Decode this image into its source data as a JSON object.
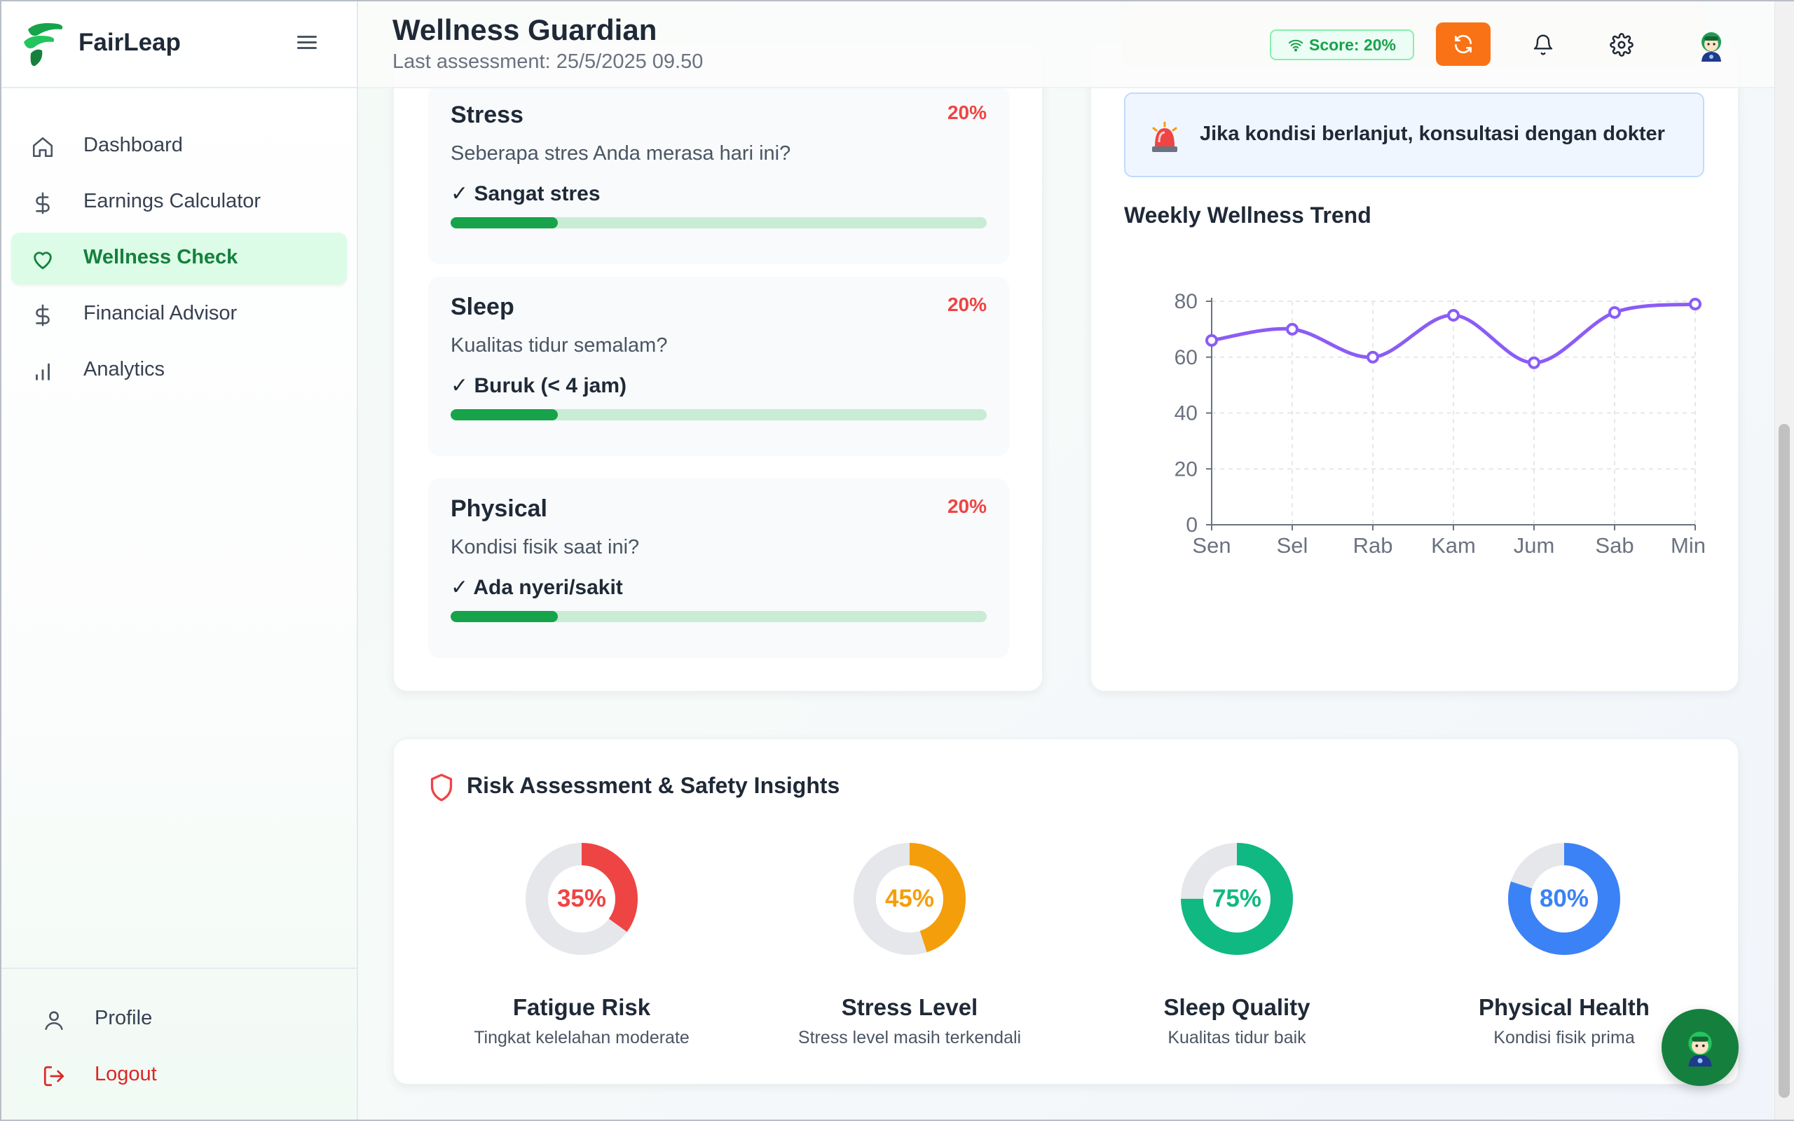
{
  "app": {
    "brand": "FairLeap"
  },
  "sidebar": {
    "items": [
      {
        "label": "Dashboard",
        "icon": "home-icon",
        "active": false
      },
      {
        "label": "Earnings Calculator",
        "icon": "dollar-icon",
        "active": false
      },
      {
        "label": "Wellness Check",
        "icon": "heart-icon",
        "active": true
      },
      {
        "label": "Financial Advisor",
        "icon": "dollar-icon",
        "active": false
      },
      {
        "label": "Analytics",
        "icon": "bar-chart-icon",
        "active": false
      }
    ],
    "bottom": [
      {
        "label": "Profile",
        "icon": "user-icon"
      },
      {
        "label": "Logout",
        "icon": "logout-icon"
      }
    ]
  },
  "header": {
    "title": "Wellness Guardian",
    "subtitle": "Last assessment: 25/5/2025 09.50",
    "score_badge": "Score: 20%"
  },
  "questions": [
    {
      "title": "Stress",
      "percent": "20%",
      "question": "Seberapa stres Anda merasa hari ini?",
      "answer": "✓ Sangat stres",
      "progress": 0.2
    },
    {
      "title": "Sleep",
      "percent": "20%",
      "question": "Kualitas tidur semalam?",
      "answer": "✓ Buruk (< 4 jam)",
      "progress": 0.2
    },
    {
      "title": "Physical",
      "percent": "20%",
      "question": "Kondisi fisik saat ini?",
      "answer": "✓ Ada nyeri/sakit",
      "progress": 0.2
    }
  ],
  "alert": {
    "text": "Jika kondisi berlanjut, konsultasi dengan dokter"
  },
  "trend": {
    "title": "Weekly Wellness Trend"
  },
  "chart_data": {
    "type": "line",
    "title": "Weekly Wellness Trend",
    "categories": [
      "Sen",
      "Sel",
      "Rab",
      "Kam",
      "Jum",
      "Sab",
      "Min"
    ],
    "values": [
      66,
      70,
      60,
      75,
      58,
      76,
      79
    ],
    "ylim": [
      0,
      80
    ],
    "yticks": [
      0,
      20,
      40,
      60,
      80
    ],
    "grid": true,
    "color": "#8b5cf6"
  },
  "risk": {
    "title": "Risk Assessment & Safety Insights",
    "items": [
      {
        "value": 35,
        "label": "35%",
        "name": "Fatigue Risk",
        "desc": "Tingkat kelelahan moderate",
        "color": "#ef4444"
      },
      {
        "value": 45,
        "label": "45%",
        "name": "Stress Level",
        "desc": "Stress level masih terkendali",
        "color": "#f59e0b"
      },
      {
        "value": 75,
        "label": "75%",
        "name": "Sleep Quality",
        "desc": "Kualitas tidur baik",
        "color": "#10b981"
      },
      {
        "value": 80,
        "label": "80%",
        "name": "Physical Health",
        "desc": "Kondisi fisik prima",
        "color": "#3b82f6"
      }
    ]
  }
}
